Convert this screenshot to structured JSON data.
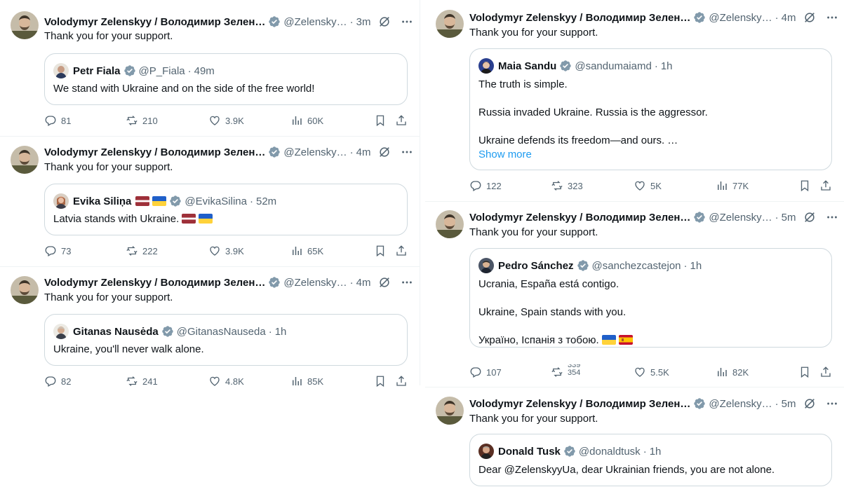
{
  "author": {
    "name": "Volodymyr Zelenskyy / Володимир Зелен…",
    "handle": "@Zelensky…",
    "text": "Thank you for your support."
  },
  "colors": {
    "accent": "#1d9bf0",
    "muted": "#536471",
    "border": "#cfd9de",
    "verified": "#829aab"
  },
  "icons": [
    "verified-badge-icon",
    "grok-icon",
    "more-icon",
    "reply-icon",
    "retweet-icon",
    "like-icon",
    "views-icon",
    "bookmark-icon",
    "share-icon"
  ],
  "tweets": [
    {
      "time": "3m",
      "quote": {
        "name": "Petr Fiala",
        "handle": "@P_Fiala",
        "time": "49m",
        "lines": [
          "We stand with Ukraine and on the side of the free world!"
        ]
      },
      "stats": {
        "replies": "81",
        "reposts": "210",
        "likes": "3.9K",
        "views": "60K"
      }
    },
    {
      "time": "4m",
      "quote": {
        "name": "Evika Siliņa",
        "handle": "@EvikaSilina",
        "time": "52m",
        "lines": [
          "Latvia stands with Ukraine."
        ]
      },
      "stats": {
        "replies": "73",
        "reposts": "222",
        "likes": "3.9K",
        "views": "65K"
      }
    },
    {
      "time": "4m",
      "quote": {
        "name": "Gitanas Nausėda",
        "handle": "@GitanasNauseda",
        "time": "1h",
        "lines": [
          "Ukraine, you'll never walk alone."
        ]
      },
      "stats": {
        "replies": "82",
        "reposts": "241",
        "likes": "4.8K",
        "views": "85K"
      }
    },
    {
      "time": "4m",
      "quote": {
        "name": "Maia Sandu",
        "handle": "@sandumaiamd",
        "time": "1h",
        "lines": [
          "The truth is simple.",
          "Russia invaded Ukraine. Russia is the aggressor.",
          "Ukraine defends its freedom—and ours. …"
        ],
        "show_more": "Show more"
      },
      "stats": {
        "replies": "122",
        "reposts": "323",
        "likes": "5K",
        "views": "77K"
      }
    },
    {
      "time": "5m",
      "quote": {
        "name": "Pedro Sánchez",
        "handle": "@sanchezcastejon",
        "time": "1h",
        "lines": [
          "Ucrania, España está contigo.",
          "Ukraine, Spain stands with you.",
          "Україно, Іспанія з тобою."
        ]
      },
      "stats": {
        "replies": "107",
        "reposts_old": "339",
        "reposts_new": "354",
        "likes": "5.5K",
        "views": "82K"
      }
    },
    {
      "time": "5m",
      "quote": {
        "name": "Donald Tusk",
        "handle": "@donaldtusk",
        "time": "1h",
        "lines": [
          "Dear @ZelenskyyUa, dear Ukrainian friends, you are not alone."
        ]
      }
    }
  ]
}
